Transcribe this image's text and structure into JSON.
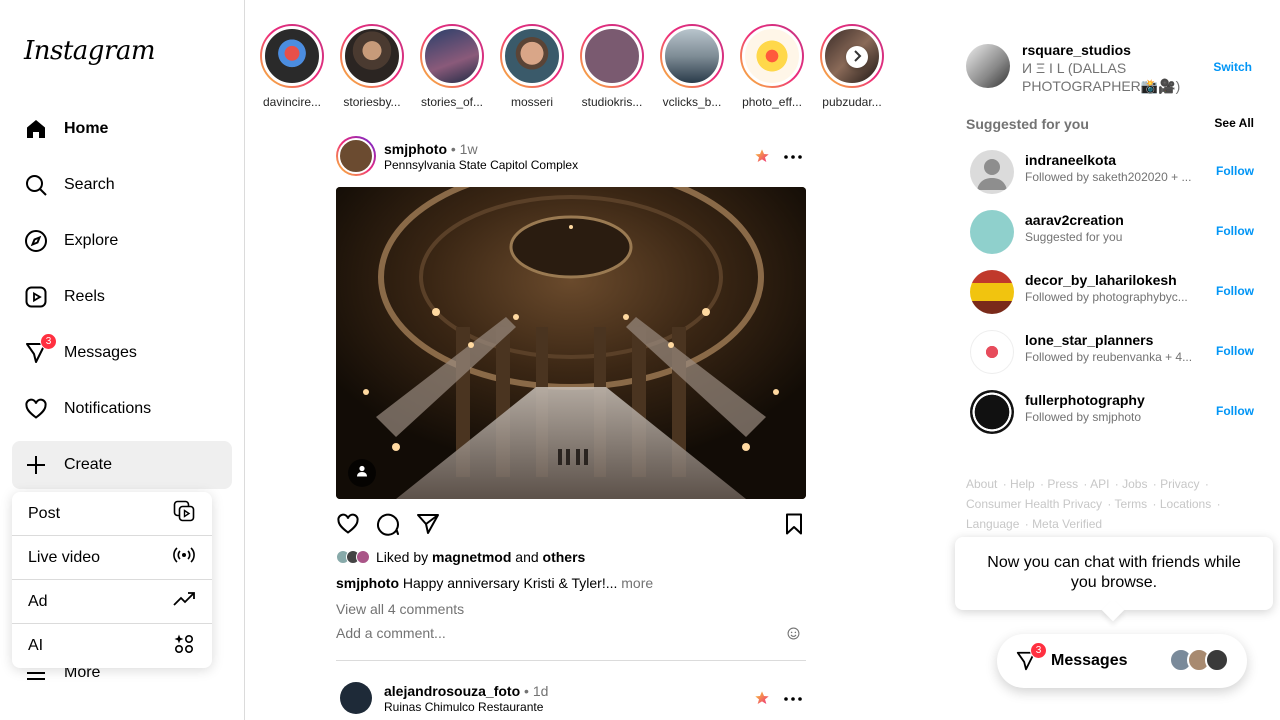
{
  "app": {
    "logo_text": "Instagram"
  },
  "nav": {
    "items": [
      {
        "label": "Home",
        "icon": "home-icon"
      },
      {
        "label": "Search",
        "icon": "search-icon"
      },
      {
        "label": "Explore",
        "icon": "compass-icon"
      },
      {
        "label": "Reels",
        "icon": "reels-icon"
      },
      {
        "label": "Messages",
        "icon": "messenger-icon",
        "badge": "3"
      },
      {
        "label": "Notifications",
        "icon": "heart-icon"
      },
      {
        "label": "Create",
        "icon": "plus-icon"
      },
      {
        "label": "More",
        "icon": "menu-icon"
      }
    ]
  },
  "create_menu": {
    "items": [
      {
        "label": "Post",
        "icon": "post-icon"
      },
      {
        "label": "Live video",
        "icon": "live-icon"
      },
      {
        "label": "Ad",
        "icon": "trending-icon"
      },
      {
        "label": "AI",
        "icon": "ai-icon"
      }
    ]
  },
  "stories": [
    {
      "name": "davincire..."
    },
    {
      "name": "storiesby..."
    },
    {
      "name": "stories_of..."
    },
    {
      "name": "mosseri"
    },
    {
      "name": "studiokris..."
    },
    {
      "name": "vclicks_b..."
    },
    {
      "name": "photo_eff..."
    },
    {
      "name": "pubzudar..."
    }
  ],
  "post": {
    "username": "smjphoto",
    "time": "• 1w",
    "location": "Pennsylvania State Capitol Complex",
    "liked_prefix": "Liked by",
    "liked_user": "magnetmod",
    "liked_and": "and",
    "liked_others": "others",
    "caption_user": "smjphoto",
    "caption_text": "Happy anniversary Kristi & Tyler!...",
    "caption_more": "more",
    "view_comments": "View all 4 comments",
    "comment_placeholder": "Add a comment..."
  },
  "post2": {
    "username": "alejandrosouza_foto",
    "time": "• 1d",
    "location": "Ruinas Chimulco Restaurante"
  },
  "account": {
    "username": "rsquare_studios",
    "full_name": "И Ξ I L (DALLAS PHOTOGRAPHER📸🎥)",
    "switch_label": "Switch"
  },
  "suggestions": {
    "title": "Suggested for you",
    "see_all": "See All",
    "follow_label": "Follow",
    "items": [
      {
        "username": "indraneelkota",
        "sub": "Followed by saketh202020 + ..."
      },
      {
        "username": "aarav2creation",
        "sub": "Suggested for you"
      },
      {
        "username": "decor_by_laharilokesh",
        "sub": "Followed by photographybyc..."
      },
      {
        "username": "lone_star_planners",
        "sub": "Followed by reubenvanka + 4..."
      },
      {
        "username": "fullerphotography",
        "sub": "Followed by smjphoto"
      }
    ]
  },
  "footer": {
    "links": [
      "About",
      "Help",
      "Press",
      "API",
      "Jobs",
      "Privacy",
      "Consumer Health Privacy",
      "Terms",
      "Locations",
      "Language",
      "Meta Verified"
    ]
  },
  "chat_tooltip": "Now you can chat with friends while you browse.",
  "messages_pill": {
    "label": "Messages",
    "badge": "3"
  },
  "colors": {
    "accent": "#0095f6",
    "badge": "#ff3040",
    "muted": "#737373"
  }
}
